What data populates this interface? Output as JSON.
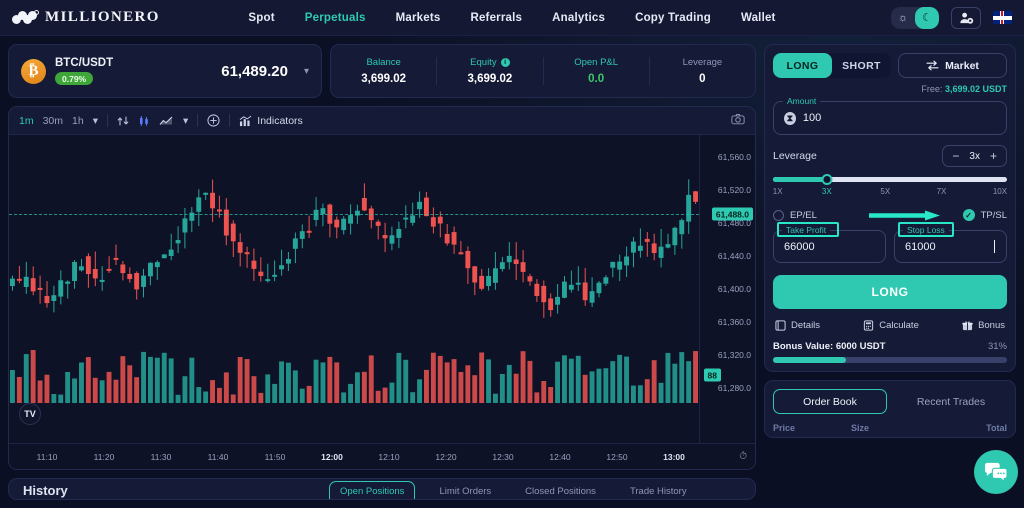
{
  "header": {
    "brand": "MILLIONERO",
    "nav": [
      {
        "label": "Spot",
        "active": false
      },
      {
        "label": "Perpetuals",
        "active": true
      },
      {
        "label": "Markets",
        "active": false
      },
      {
        "label": "Referrals",
        "active": false
      },
      {
        "label": "Analytics",
        "active": false
      },
      {
        "label": "Copy Trading",
        "active": false
      },
      {
        "label": "Wallet",
        "active": false
      }
    ],
    "theme": {
      "light_icon": "sun-icon",
      "dark_icon": "moon-icon",
      "active": "dark"
    },
    "account_icon": "user-account-icon",
    "language_flag": "uk-flag"
  },
  "ticker": {
    "coin_symbol": "₿",
    "pair": "BTC/USDT",
    "change_badge": "0.79%",
    "price": "61,489.20",
    "caret": "chevron-down-icon"
  },
  "stats": [
    {
      "label": "Balance",
      "value": "3,699.02",
      "info": false,
      "green": false
    },
    {
      "label": "Equity",
      "value": "3,699.02",
      "info": true,
      "green": false
    },
    {
      "label": "Open P&L",
      "value": "0.0",
      "info": false,
      "green": true
    },
    {
      "label": "Leverage",
      "value": "0",
      "info": false,
      "green": false
    }
  ],
  "chart": {
    "timeframes": [
      {
        "label": "1m",
        "active": true
      },
      {
        "label": "30m",
        "active": false
      },
      {
        "label": "1h",
        "active": false
      }
    ],
    "indicators_label": "Indicators",
    "camera_icon": "screenshot-camera-icon",
    "y_ticks": [
      "61,560.0",
      "61,520.0",
      "61,480.0",
      "61,440.0",
      "61,400.0",
      "61,360.0",
      "61,320.0",
      "61,280.0"
    ],
    "current_price_tag": "61,488.0",
    "volume_tag": "88",
    "x_ticks": [
      {
        "label": "11:10",
        "bold": false
      },
      {
        "label": "11:20",
        "bold": false
      },
      {
        "label": "11:30",
        "bold": false
      },
      {
        "label": "11:40",
        "bold": false
      },
      {
        "label": "11:50",
        "bold": false
      },
      {
        "label": "12:00",
        "bold": true
      },
      {
        "label": "12:10",
        "bold": false
      },
      {
        "label": "12:20",
        "bold": false
      },
      {
        "label": "12:30",
        "bold": false
      },
      {
        "label": "12:40",
        "bold": false
      },
      {
        "label": "12:50",
        "bold": false
      },
      {
        "label": "13:00",
        "bold": true
      }
    ],
    "tv_logo": "TV",
    "up_color": "#26a69a",
    "down_color": "#ef5350"
  },
  "history": {
    "title": "History",
    "tabs": [
      {
        "label": "Open Positions",
        "active": true
      },
      {
        "label": "Limit Orders",
        "active": false
      },
      {
        "label": "Closed Positions",
        "active": false
      },
      {
        "label": "Trade History",
        "active": false
      }
    ]
  },
  "order": {
    "side_long": "LONG",
    "side_short": "SHORT",
    "order_type": "Market",
    "order_type_icon": "swap-arrows-icon",
    "free_prefix": "Free:",
    "free_value": "3,699.02 USDT",
    "amount_label": "Amount",
    "amount_value": "100",
    "amount_icon": "usdt-icon",
    "leverage_label": "Leverage",
    "leverage_value": "3x",
    "leverage_ticks": [
      {
        "label": "1X",
        "active": false
      },
      {
        "label": "3X",
        "active": true
      },
      {
        "label": "5X",
        "active": false
      },
      {
        "label": "7X",
        "active": false
      },
      {
        "label": "10X",
        "active": false
      }
    ],
    "epel_label": "EP/EL",
    "epel_checked": false,
    "tpsl_label": "TP/SL",
    "tpsl_checked": true,
    "take_profit_label": "Take Profit",
    "take_profit_value": "66000",
    "stop_loss_label": "Stop Loss",
    "stop_loss_value": "61000",
    "submit_label": "LONG",
    "links": [
      {
        "label": "Details",
        "icon": "details-icon"
      },
      {
        "label": "Calculate",
        "icon": "calculator-icon"
      },
      {
        "label": "Bonus",
        "icon": "gift-icon"
      }
    ],
    "bonus_text": "Bonus Value: 6000 USDT",
    "bonus_pct": "31%",
    "bonus_fill": 31,
    "accent": "#2ec9b0",
    "annotation_color": "#27e7c8"
  },
  "orderbook": {
    "tabs": [
      {
        "label": "Order Book",
        "active": true
      },
      {
        "label": "Recent Trades",
        "active": false
      }
    ],
    "columns": [
      "Price",
      "Size",
      "Total"
    ],
    "chat_icon": "chat-bubble-icon"
  }
}
